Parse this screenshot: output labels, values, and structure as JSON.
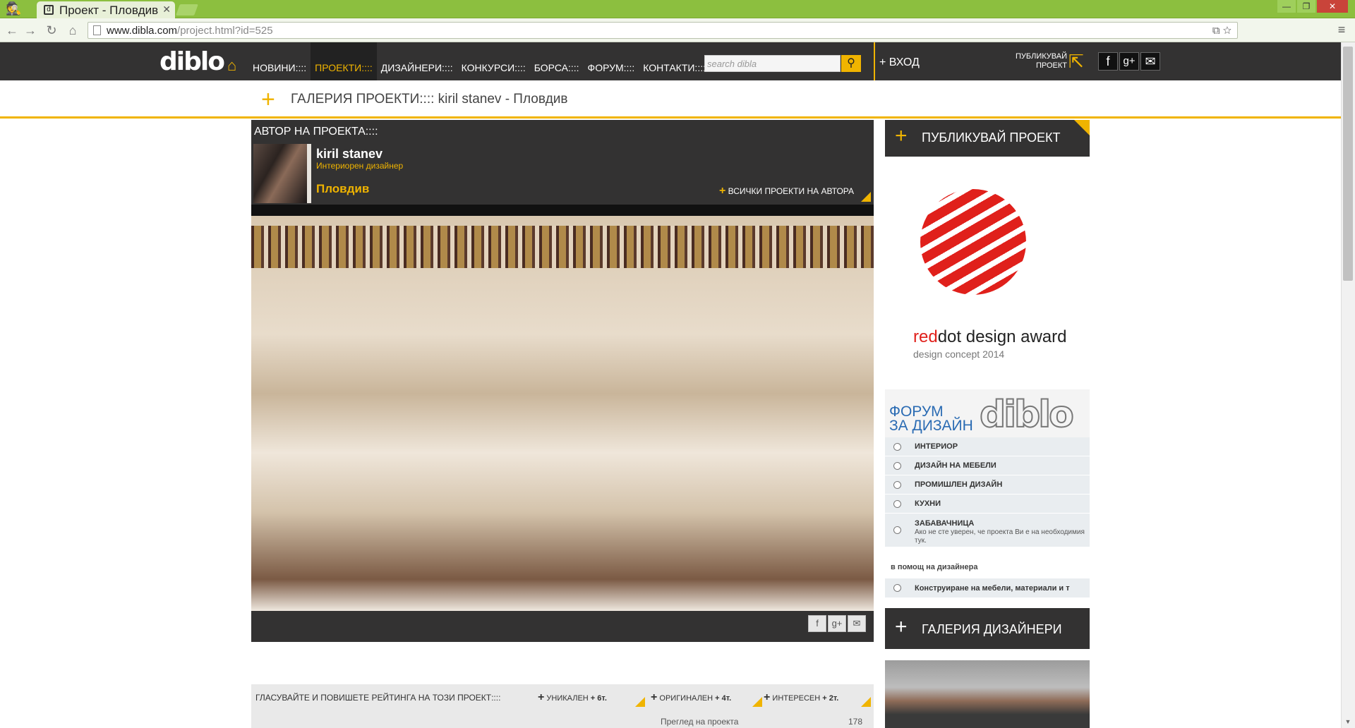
{
  "browser": {
    "tab_title": "Проект - Пловдив",
    "url_host": "www.dibla.com",
    "url_path": "/project.html?id=525"
  },
  "header": {
    "logo": "diblo",
    "nav": [
      "НОВИНИ::::",
      "ПРОЕКТИ::::",
      "ДИЗАЙНЕРИ::::",
      "КОНКУРСИ::::",
      "БОРСА::::",
      "ФОРУМ::::",
      "КОНТАКТИ::::"
    ],
    "search_placeholder": "search dibla",
    "login": "ВХОД",
    "publish_line1": "ПУБЛИКУВАЙ",
    "publish_line2": "ПРОЕКТ",
    "social": [
      "f",
      "g+",
      "✉"
    ]
  },
  "breadcrumb": {
    "text": "ГАЛЕРИЯ ПРОЕКТИ::::   kiril stanev - Пловдив"
  },
  "author": {
    "label": "АВТОР НА ПРОЕКТА::::",
    "name": "kiril stanev",
    "role": "Интериорен дизайнер",
    "city": "Пловдив",
    "all_projects": "ВСИЧКИ ПРОЕКТИ НА АВТОРА"
  },
  "share": [
    "f",
    "g+",
    "✉"
  ],
  "vote": {
    "text": "ГЛАСУВАЙТЕ И ПОВИШЕТЕ РЕЙТИНГА НА ТОЗИ ПРОЕКТ::::",
    "options": [
      {
        "label": "УНИКАЛЕН",
        "points": "+ 6т."
      },
      {
        "label": "ОРИГИНАЛЕН",
        "points": "+ 4т."
      },
      {
        "label": "ИНТЕРЕСЕН",
        "points": "+ 2т."
      }
    ],
    "views_label": "Преглед на проекта",
    "views_value": "178"
  },
  "sidebar": {
    "publish": "ПУБЛИКУВАЙ ПРОЕКТ",
    "reddot_red": "red",
    "reddot_dot": "dot design award",
    "reddot_sub": "design concept 2014",
    "forum_title_1": "ФОРУМ",
    "forum_title_2": "ЗА ДИЗАЙН",
    "forum_logo": "diblo",
    "forum_items": [
      "ИНТЕРИОР",
      "ДИЗАЙН НА МЕБЕЛИ",
      "ПРОМИШЛЕН ДИЗАЙН",
      "КУХНИ",
      "ЗАБАВАЧНИЦА"
    ],
    "forum_note": "Ако не сте уверен, че проекта Ви е на необходимия тук.",
    "helper": "в помощ на дизайнера",
    "helper_item": "Конструиране на мебели, материали и т",
    "gallery": "ГАЛЕРИЯ ДИЗАЙНЕРИ"
  }
}
